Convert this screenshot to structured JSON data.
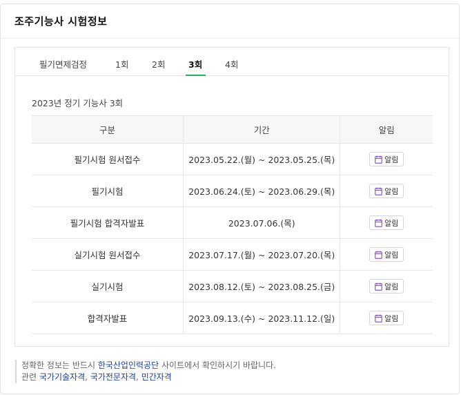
{
  "header": {
    "title": "조주기능사 시험정보"
  },
  "tabs": [
    {
      "label": "필기면제검정"
    },
    {
      "label": "1회"
    },
    {
      "label": "2회"
    },
    {
      "label": "3회"
    },
    {
      "label": "4회"
    }
  ],
  "active_tab": "3회",
  "accent_color": "#19b55c",
  "alarm_icon_color": "#8b57c5",
  "subtitle": "2023년 정기 기능사 3회",
  "table": {
    "headers": [
      "구분",
      "기간",
      "알림"
    ],
    "rows": [
      {
        "category": "필기시험 원서접수",
        "period": "2023.05.22.(월) ~ 2023.05.25.(목)",
        "alarm": "알림"
      },
      {
        "category": "필기시험",
        "period": "2023.06.24.(토) ~ 2023.06.29.(목)",
        "alarm": "알림"
      },
      {
        "category": "필기시험 합격자발표",
        "period": "2023.07.06.(목)",
        "alarm": "알림"
      },
      {
        "category": "실기시험 원서접수",
        "period": "2023.07.17.(월) ~ 2023.07.20.(목)",
        "alarm": "알림"
      },
      {
        "category": "실기시험",
        "period": "2023.08.12.(토) ~ 2023.08.25.(금)",
        "alarm": "알림"
      },
      {
        "category": "합격자발표",
        "period": "2023.09.13.(수) ~ 2023.11.12.(일)",
        "alarm": "알림"
      }
    ]
  },
  "footer": {
    "line1_prefix": "정확한 정보는 반드시 ",
    "line1_link": "한국산업인력공단",
    "line1_suffix": " 사이트에서 확인하시기 바랍니다.",
    "line2_prefix": "관련 ",
    "line2_links": [
      "국가기술자격",
      "국가전문자격",
      "민간자격"
    ]
  }
}
